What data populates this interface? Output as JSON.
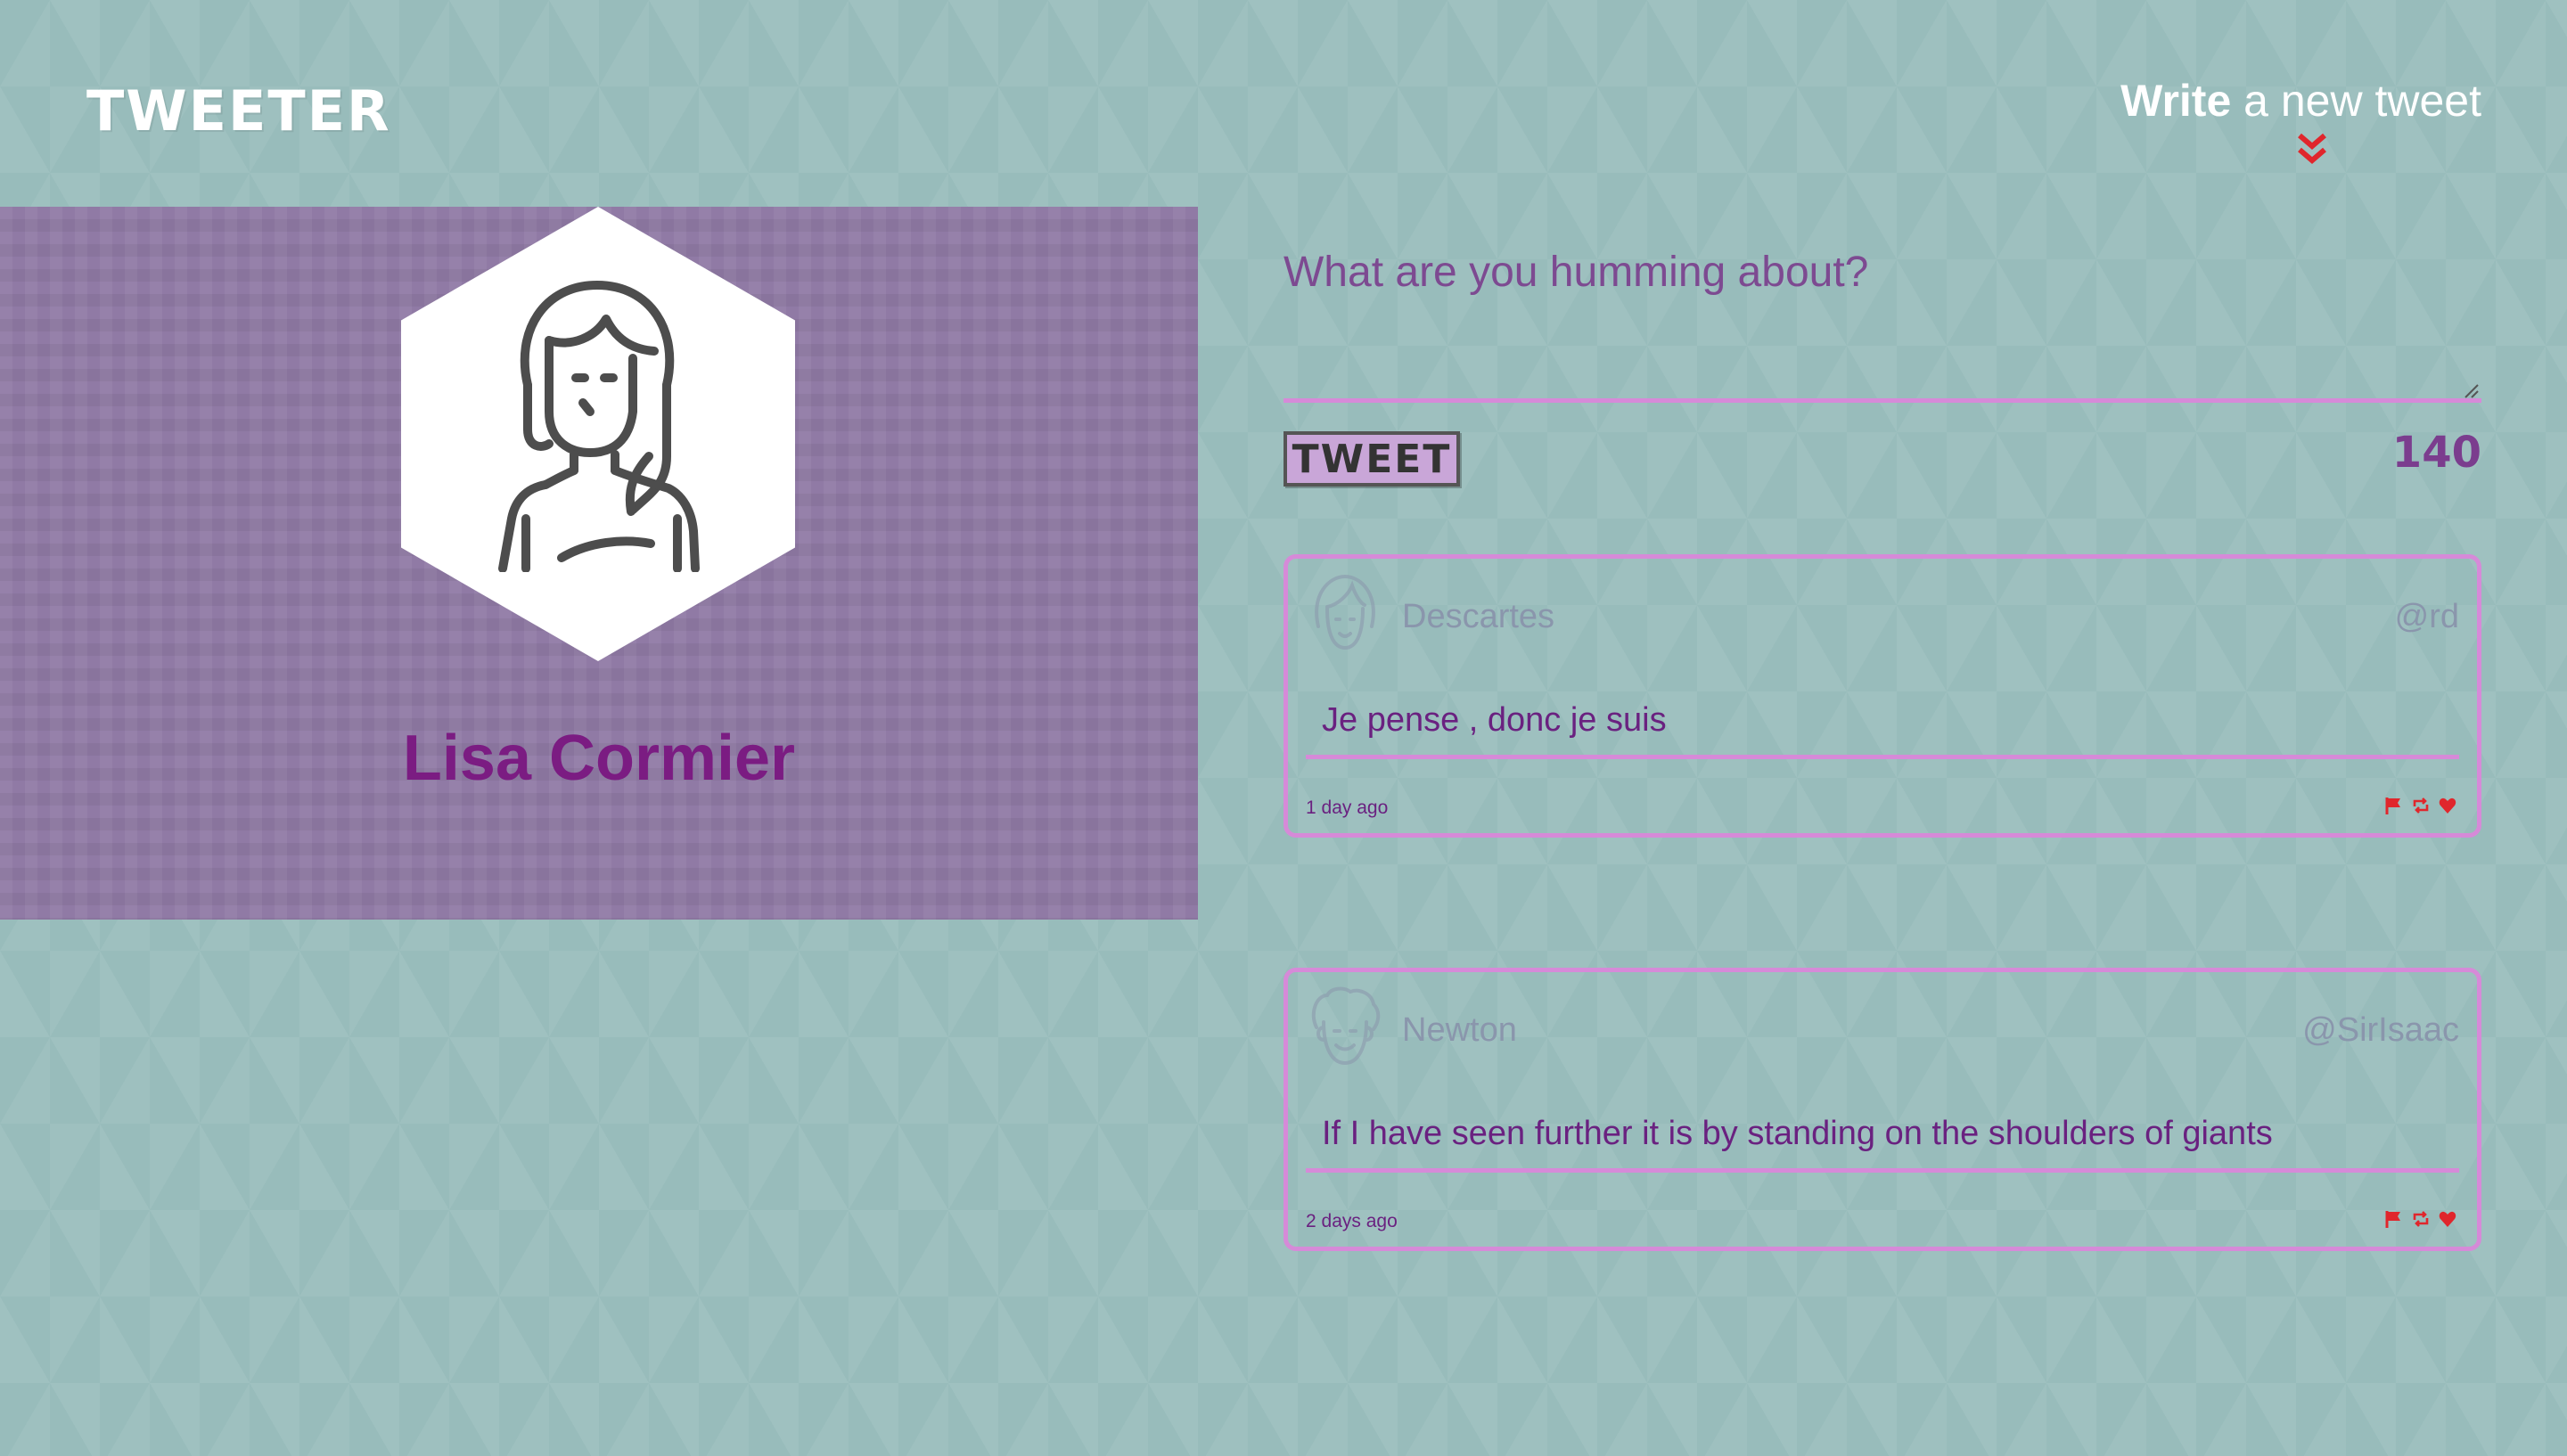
{
  "app": {
    "title": "TWEETER"
  },
  "nav": {
    "compose_strong": "Write",
    "compose_rest": " a new tweet"
  },
  "profile": {
    "name": "Lisa Cormier"
  },
  "compose": {
    "placeholder": "What are you humming about?",
    "button_label": "TWEET",
    "char_count": "140"
  },
  "tweets": [
    {
      "user": "Descartes",
      "handle": "@rd",
      "text": "Je pense , donc je suis",
      "time": "1 day ago"
    },
    {
      "user": "Newton",
      "handle": "@SirIsaac",
      "text": "If I have seen further it is by standing on the shoulders of giants",
      "time": "2 days ago"
    }
  ],
  "icons": {
    "compose_toggle": "double-chevron-down-icon",
    "flag": "flag-icon",
    "retweet": "retweet-icon",
    "like": "heart-icon"
  },
  "colors": {
    "background": "#98bcbb",
    "profile_panel": "#907aa5",
    "accent_pink": "#d68ad8",
    "name_purple": "#7b1c82",
    "action_red": "#e0262c"
  }
}
